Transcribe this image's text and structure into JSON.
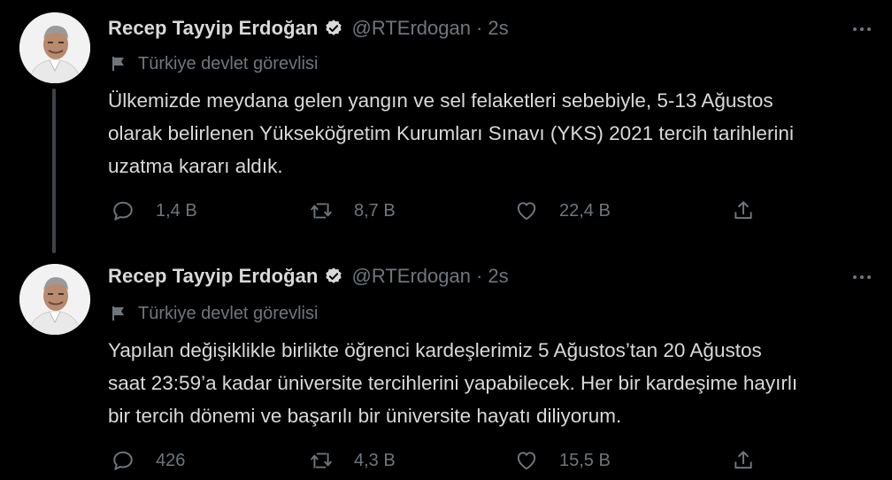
{
  "tweets": [
    {
      "author_name": "Recep Tayyip Erdoğan",
      "handle": "@RTErdogan",
      "separator": "·",
      "time": "2s",
      "label": "Türkiye devlet görevlisi",
      "body_lines": [
        "Ülkemizde meydana gelen yangın ve sel felaketleri sebebiyle, 5-13 Ağustos",
        "olarak belirlenen Yükseköğretim Kurumları Sınavı (YKS) 2021 tercih tarihlerini",
        "uzatma kararı aldık."
      ],
      "replies": "1,4 B",
      "retweets": "8,7 B",
      "likes": "22,4 B"
    },
    {
      "author_name": "Recep Tayyip Erdoğan",
      "handle": "@RTErdogan",
      "separator": "·",
      "time": "2s",
      "label": "Türkiye devlet görevlisi",
      "body_lines": [
        "Yapılan değişiklikle birlikte öğrenci kardeşlerimiz 5 Ağustos’tan 20 Ağustos",
        "saat 23:59’a kadar üniversite tercihlerini yapabilecek. Her bir kardeşime hayırlı",
        "bir tercih dönemi ve başarılı bir üniversite hayatı diliyorum."
      ],
      "replies": "426",
      "retweets": "4,3 B",
      "likes": "15,5 B"
    }
  ],
  "icons": {
    "verified": "verified-badge-icon",
    "label": "flag-icon",
    "more": "more-options-icon",
    "reply": "reply-icon",
    "retweet": "retweet-icon",
    "like": "heart-icon",
    "share": "share-icon"
  },
  "colors": {
    "background": "#000000",
    "primary_text": "#d9d9d9",
    "secondary_text": "#6e767d",
    "thread_line": "#3d4247"
  }
}
